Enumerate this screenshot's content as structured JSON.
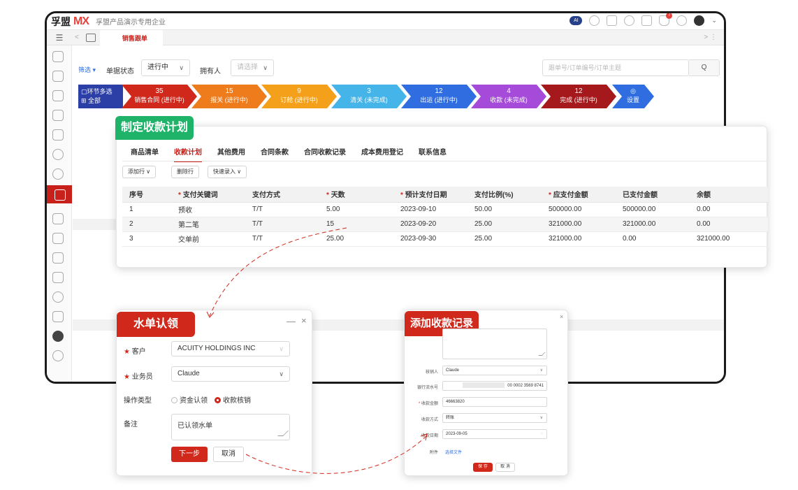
{
  "app": {
    "brand_cn": "孚盟",
    "brand_mx": "MX",
    "company": "孚盟产品演示专用企业",
    "notification_count": "7",
    "ai_label": "AI"
  },
  "tabs": {
    "active_label": "销售跟单",
    "menu_glyph": "☰",
    "nav_glyph": "<",
    "right_glyph": "> ⋮"
  },
  "filter": {
    "filter_label": "筛选 ▾",
    "status_label": "单据状态",
    "status_value": "进行中",
    "owner_label": "拥有人",
    "owner_placeholder": "请选择",
    "search_placeholder": "跟单号/订单编号/订单主题",
    "search_button": "Q"
  },
  "pipeline": {
    "all_line1": "▢环节多选",
    "all_line2": "⊞ 全部",
    "steps": [
      {
        "count": "35",
        "label": "销售合同 (进行中)",
        "color": "#d1281c"
      },
      {
        "count": "15",
        "label": "报关 (进行中)",
        "color": "#ee7b1c"
      },
      {
        "count": "9",
        "label": "订舱 (进行中)",
        "color": "#f5a01a"
      },
      {
        "count": "3",
        "label": "清关 (未完成)",
        "color": "#45b4e8"
      },
      {
        "count": "12",
        "label": "出运 (进行中)",
        "color": "#2f6de1"
      },
      {
        "count": "4",
        "label": "收款 (未完成)",
        "color": "#a54ad9"
      },
      {
        "count": "12",
        "label": "完成 (进行中)",
        "color": "#a5191c"
      }
    ],
    "settings_label": "设置",
    "settings_icon": "◎"
  },
  "plan": {
    "title": "制定收款计划",
    "tabs": [
      "商品清单",
      "收款计划",
      "其他费用",
      "合同条款",
      "合同收款记录",
      "成本费用登记",
      "联系信息"
    ],
    "buttons": {
      "add": "添加行 ∨",
      "delete": "删除行",
      "quick": "快速录入 ∨"
    },
    "columns": [
      "序号",
      "支付关键词",
      "支付方式",
      "天数",
      "预计支付日期",
      "支付比例(%)",
      "应支付金额",
      "已支付金额",
      "余额"
    ],
    "required_mark": "*",
    "rows": [
      [
        "1",
        "预收",
        "T/T",
        "5.00",
        "2023-09-10",
        "50.00",
        "500000.00",
        "500000.00",
        "0.00"
      ],
      [
        "2",
        "第二笔",
        "T/T",
        "15",
        "2023-09-20",
        "25.00",
        "321000.00",
        "321000.00",
        "0.00"
      ],
      [
        "3",
        "交单前",
        "T/T",
        "25.00",
        "2023-09-30",
        "25.00",
        "321000.00",
        "0.00",
        "321000.00"
      ]
    ]
  },
  "claim": {
    "title": "水单认领",
    "minimize": "—",
    "close": "×",
    "customer_label": "客户",
    "customer_value": "ACUITY HOLDINGS INC",
    "sales_label": "业务员",
    "sales_value": "Claude",
    "op_label": "操作类型",
    "op_option1": "资金认领",
    "op_option2": "收款核销",
    "note_label": "备注",
    "note_value": "已认领水单",
    "next_button": "下一步",
    "cancel_button": "取消"
  },
  "record": {
    "title": "添加收款记录",
    "close": "×",
    "verifier_label": "核销人",
    "verifier_value": "Claude",
    "bank_label": "银行流水号",
    "bank_value": "00 0002 3569 8741",
    "amount_label": "收款金额",
    "amount_value": "46663820",
    "method_label": "收款方式",
    "method_value": "转账",
    "date_label": "收款日期",
    "date_value": "2023-09-05",
    "attach_label": "附件",
    "attach_link": "选择文件",
    "save_button": "保 存",
    "cancel_button": "取 消",
    "required_mark": "*"
  }
}
